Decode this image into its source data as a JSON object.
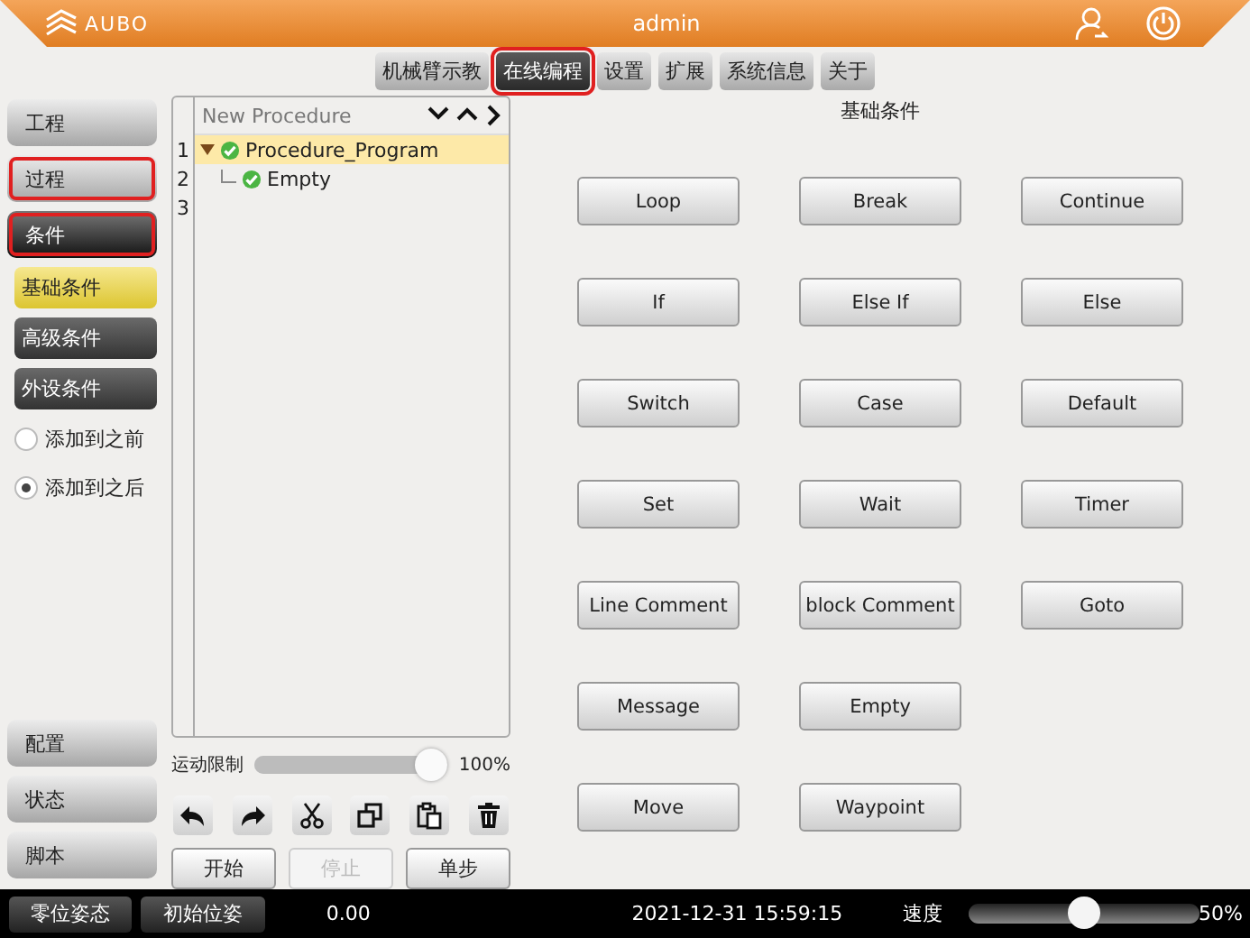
{
  "header": {
    "logo": "AUBO",
    "user": "admin"
  },
  "top_tabs": [
    {
      "label": "机械臂示教",
      "selected": false,
      "highlighted": false
    },
    {
      "label": "在线编程",
      "selected": true,
      "highlighted": true
    },
    {
      "label": "设置",
      "selected": false,
      "highlighted": false
    },
    {
      "label": "扩展",
      "selected": false,
      "highlighted": false
    },
    {
      "label": "系统信息",
      "selected": false,
      "highlighted": false
    },
    {
      "label": "关于",
      "selected": false,
      "highlighted": false
    }
  ],
  "sidebar": {
    "items": [
      {
        "label": "工程",
        "selected": false,
        "highlighted": false
      },
      {
        "label": "过程",
        "selected": false,
        "highlighted": true
      },
      {
        "label": "条件",
        "selected": true,
        "highlighted": true
      }
    ],
    "sub_items": [
      {
        "label": "基础条件",
        "selected": true
      },
      {
        "label": "高级条件",
        "selected": false
      },
      {
        "label": "外设条件",
        "selected": false
      }
    ],
    "insert_options": [
      {
        "label": "添加到之前",
        "selected": false
      },
      {
        "label": "添加到之后",
        "selected": true
      }
    ],
    "bottom_items": [
      {
        "label": "配置"
      },
      {
        "label": "状态"
      },
      {
        "label": "脚本"
      }
    ]
  },
  "tree": {
    "title": "New Procedure",
    "line_numbers": [
      "1",
      "2",
      "3"
    ],
    "nodes": [
      {
        "label": "Procedure_Program",
        "expanded": true,
        "selected": true,
        "children": [
          {
            "label": "Empty",
            "selected": false
          }
        ]
      }
    ]
  },
  "motion_limit": {
    "label": "运动限制",
    "level": 1.0,
    "reading": "100%"
  },
  "run_buttons": [
    {
      "label": "开始",
      "disabled": false
    },
    {
      "label": "停止",
      "disabled": true
    },
    {
      "label": "单步",
      "disabled": false
    }
  ],
  "panel": {
    "title": "基础条件",
    "rows": [
      [
        "Loop",
        "Break",
        "Continue"
      ],
      [
        "If",
        "Else If",
        "Else"
      ],
      [
        "Switch",
        "Case",
        "Default"
      ],
      [
        "Set",
        "Wait",
        "Timer"
      ],
      [
        "Line Comment",
        "block Comment",
        "Goto"
      ],
      [
        "Message",
        "Empty"
      ],
      [
        "Move",
        "Waypoint"
      ]
    ]
  },
  "status_bar": {
    "buttons": [
      "零位姿态",
      "初始位姿"
    ],
    "value": "0.00",
    "datetime": "2021-12-31 15:59:15",
    "speed_label": "速度",
    "speed": {
      "level": 0.5
    },
    "speed_reading": "50%"
  }
}
